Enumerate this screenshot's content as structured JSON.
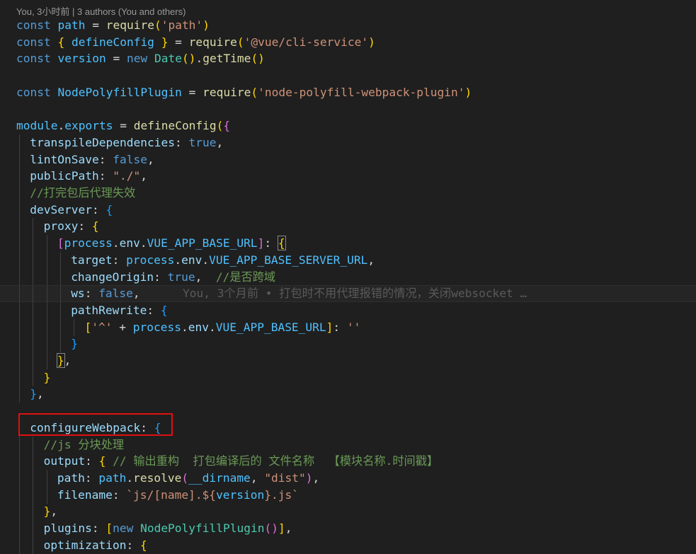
{
  "codelens": "You, 3小时前 | 3 authors (You and others)",
  "blame_inline": "You, 3个月前 • 打包时不用代理报错的情况，关闭websocket …",
  "colors": {
    "background": "#1f1f1f",
    "keyword": "#569cd6",
    "string": "#ce9178",
    "comment": "#6a9955",
    "function": "#dcdcaa",
    "property": "#9cdcfe",
    "highlight_box": "#e01010"
  },
  "lines": [
    {
      "indent": 0,
      "tokens": [
        [
          "kw",
          "const"
        ],
        [
          "pl",
          " "
        ],
        [
          "var",
          "path"
        ],
        [
          "pl",
          " = "
        ],
        [
          "fn",
          "require"
        ],
        [
          "b1",
          "("
        ],
        [
          "str",
          "'path'"
        ],
        [
          "b1",
          ")"
        ]
      ]
    },
    {
      "indent": 0,
      "tokens": [
        [
          "kw",
          "const"
        ],
        [
          "pl",
          " "
        ],
        [
          "b1",
          "{"
        ],
        [
          "pl",
          " "
        ],
        [
          "var",
          "defineConfig"
        ],
        [
          "pl",
          " "
        ],
        [
          "b1",
          "}"
        ],
        [
          "pl",
          " = "
        ],
        [
          "fn",
          "require"
        ],
        [
          "b1",
          "("
        ],
        [
          "str",
          "'@vue/cli-service'"
        ],
        [
          "b1",
          ")"
        ]
      ]
    },
    {
      "indent": 0,
      "tokens": [
        [
          "kw",
          "const"
        ],
        [
          "pl",
          " "
        ],
        [
          "var",
          "version"
        ],
        [
          "pl",
          " = "
        ],
        [
          "kw",
          "new"
        ],
        [
          "pl",
          " "
        ],
        [
          "cls",
          "Date"
        ],
        [
          "b1",
          "()"
        ],
        [
          "pl",
          "."
        ],
        [
          "fn",
          "getTime"
        ],
        [
          "b1",
          "()"
        ]
      ]
    },
    {
      "indent": 0,
      "tokens": []
    },
    {
      "indent": 0,
      "tokens": [
        [
          "kw",
          "const"
        ],
        [
          "pl",
          " "
        ],
        [
          "var",
          "NodePolyfillPlugin"
        ],
        [
          "pl",
          " = "
        ],
        [
          "fn",
          "require"
        ],
        [
          "b1",
          "("
        ],
        [
          "str",
          "'node-polyfill-webpack-plugin'"
        ],
        [
          "b1",
          ")"
        ]
      ]
    },
    {
      "indent": 0,
      "tokens": []
    },
    {
      "indent": 0,
      "tokens": [
        [
          "var",
          "module"
        ],
        [
          "pl",
          "."
        ],
        [
          "var",
          "exports"
        ],
        [
          "pl",
          " = "
        ],
        [
          "fn",
          "defineConfig"
        ],
        [
          "b1",
          "("
        ],
        [
          "b2",
          "{"
        ]
      ]
    },
    {
      "indent": 1,
      "tokens": [
        [
          "prop",
          "transpileDependencies"
        ],
        [
          "pl",
          ": "
        ],
        [
          "kw",
          "true"
        ],
        [
          "pl",
          ","
        ]
      ]
    },
    {
      "indent": 1,
      "tokens": [
        [
          "prop",
          "lintOnSave"
        ],
        [
          "pl",
          ": "
        ],
        [
          "kw",
          "false"
        ],
        [
          "pl",
          ","
        ]
      ]
    },
    {
      "indent": 1,
      "tokens": [
        [
          "prop",
          "publicPath"
        ],
        [
          "pl",
          ": "
        ],
        [
          "str",
          "\"./\""
        ],
        [
          "pl",
          ","
        ]
      ]
    },
    {
      "indent": 1,
      "tokens": [
        [
          "cm",
          "//打完包后代理失效"
        ]
      ]
    },
    {
      "indent": 1,
      "tokens": [
        [
          "prop",
          "devServer"
        ],
        [
          "pl",
          ": "
        ],
        [
          "b3",
          "{"
        ]
      ]
    },
    {
      "indent": 2,
      "tokens": [
        [
          "prop",
          "proxy"
        ],
        [
          "pl",
          ": "
        ],
        [
          "b1",
          "{"
        ]
      ]
    },
    {
      "indent": 3,
      "tokens": [
        [
          "b2",
          "["
        ],
        [
          "var",
          "process"
        ],
        [
          "pl",
          "."
        ],
        [
          "prop",
          "env"
        ],
        [
          "pl",
          "."
        ],
        [
          "var",
          "VUE_APP_BASE_URL"
        ],
        [
          "b2",
          "]"
        ],
        [
          "pl",
          ": "
        ],
        [
          "b3x",
          "{"
        ]
      ]
    },
    {
      "indent": 4,
      "tokens": [
        [
          "prop",
          "target"
        ],
        [
          "pl",
          ": "
        ],
        [
          "var",
          "process"
        ],
        [
          "pl",
          "."
        ],
        [
          "prop",
          "env"
        ],
        [
          "pl",
          "."
        ],
        [
          "var",
          "VUE_APP_BASE_SERVER_URL"
        ],
        [
          "pl",
          ","
        ]
      ]
    },
    {
      "indent": 4,
      "tokens": [
        [
          "prop",
          "changeOrigin"
        ],
        [
          "pl",
          ": "
        ],
        [
          "kw",
          "true"
        ],
        [
          "pl",
          ",  "
        ],
        [
          "cm",
          "//是否跨域"
        ]
      ]
    },
    {
      "indent": 4,
      "active": true,
      "tokens": [
        [
          "prop",
          "ws"
        ],
        [
          "pl",
          ": "
        ],
        [
          "kw",
          "false"
        ],
        [
          "pl",
          ","
        ]
      ]
    },
    {
      "indent": 4,
      "tokens": [
        [
          "prop",
          "pathRewrite"
        ],
        [
          "pl",
          ": "
        ],
        [
          "b3",
          "{"
        ]
      ]
    },
    {
      "indent": 5,
      "tokens": [
        [
          "b1",
          "["
        ],
        [
          "str",
          "'^'"
        ],
        [
          "pl",
          " + "
        ],
        [
          "var",
          "process"
        ],
        [
          "pl",
          "."
        ],
        [
          "prop",
          "env"
        ],
        [
          "pl",
          "."
        ],
        [
          "var",
          "VUE_APP_BASE_URL"
        ],
        [
          "b1",
          "]"
        ],
        [
          "pl",
          ": "
        ],
        [
          "str",
          "''"
        ]
      ]
    },
    {
      "indent": 4,
      "tokens": [
        [
          "b3",
          "}"
        ]
      ]
    },
    {
      "indent": 3,
      "tokens": [
        [
          "b3x",
          "}"
        ],
        [
          "pl",
          ","
        ]
      ]
    },
    {
      "indent": 2,
      "tokens": [
        [
          "b1",
          "}"
        ]
      ]
    },
    {
      "indent": 1,
      "tokens": [
        [
          "b3",
          "}"
        ],
        [
          "pl",
          ","
        ]
      ]
    },
    {
      "indent": 0,
      "tokens": []
    },
    {
      "indent": 1,
      "tokens": [
        [
          "prop",
          "configureWebpack"
        ],
        [
          "pl",
          ": "
        ],
        [
          "b3",
          "{"
        ]
      ]
    },
    {
      "indent": 2,
      "tokens": [
        [
          "cm",
          "//js 分块处理"
        ]
      ]
    },
    {
      "indent": 2,
      "tokens": [
        [
          "prop",
          "output"
        ],
        [
          "pl",
          ": "
        ],
        [
          "b1",
          "{"
        ],
        [
          "pl",
          " "
        ],
        [
          "cm",
          "// 输出重构  打包编译后的 文件名称  【模块名称.时间戳】"
        ]
      ]
    },
    {
      "indent": 3,
      "tokens": [
        [
          "prop",
          "path"
        ],
        [
          "pl",
          ": "
        ],
        [
          "var",
          "path"
        ],
        [
          "pl",
          "."
        ],
        [
          "fn",
          "resolve"
        ],
        [
          "b2",
          "("
        ],
        [
          "var",
          "__dirname"
        ],
        [
          "pl",
          ", "
        ],
        [
          "str",
          "\"dist\""
        ],
        [
          "b2",
          ")"
        ],
        [
          "pl",
          ","
        ]
      ]
    },
    {
      "indent": 3,
      "tokens": [
        [
          "prop",
          "filename"
        ],
        [
          "pl",
          ": "
        ],
        [
          "str",
          "`js/[name].${"
        ],
        [
          "var",
          "version"
        ],
        [
          "str",
          "}.js`"
        ]
      ]
    },
    {
      "indent": 2,
      "tokens": [
        [
          "b1",
          "}"
        ],
        [
          "pl",
          ","
        ]
      ]
    },
    {
      "indent": 2,
      "tokens": [
        [
          "prop",
          "plugins"
        ],
        [
          "pl",
          ": "
        ],
        [
          "b1",
          "["
        ],
        [
          "kw",
          "new"
        ],
        [
          "pl",
          " "
        ],
        [
          "cls",
          "NodePolyfillPlugin"
        ],
        [
          "b2",
          "()"
        ],
        [
          "b1",
          "]"
        ],
        [
          "pl",
          ","
        ]
      ]
    },
    {
      "indent": 2,
      "tokens": [
        [
          "prop",
          "optimization"
        ],
        [
          "pl",
          ": "
        ],
        [
          "b1",
          "{"
        ]
      ]
    }
  ]
}
